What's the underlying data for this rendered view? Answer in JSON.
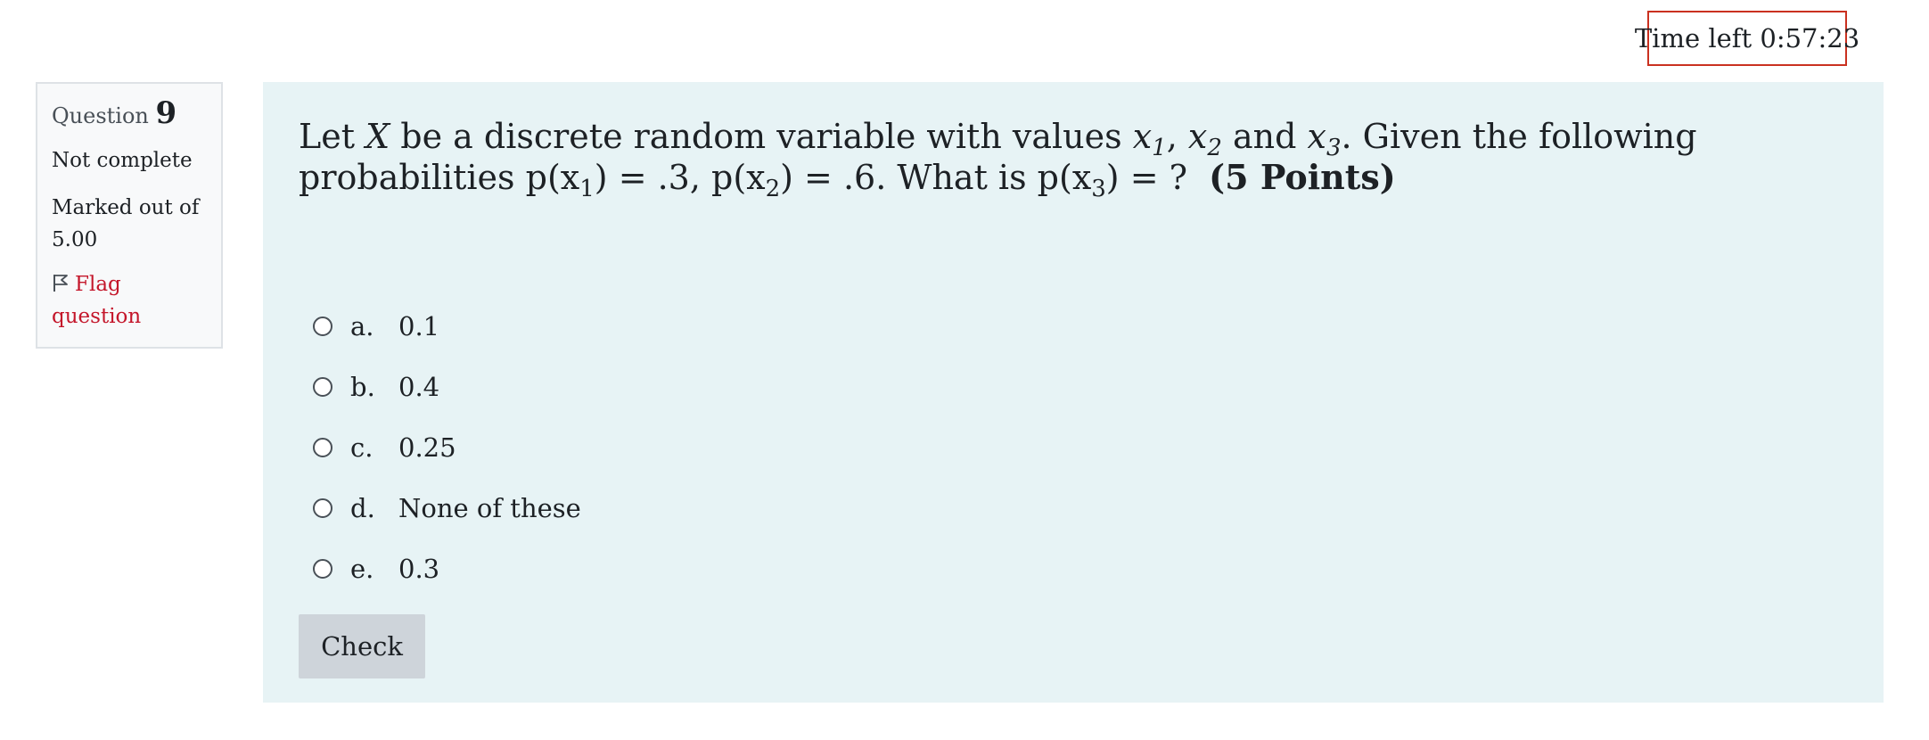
{
  "timer": {
    "label": "Time left",
    "value": "0:57:23"
  },
  "question_info": {
    "prefix": "Question",
    "number": "9",
    "state": "Not complete",
    "grade_line1": "Marked out of",
    "grade_line2": "5.00",
    "flag_line1": "Flag",
    "flag_line2": "question"
  },
  "question": {
    "let": "Let",
    "var_X": "X",
    "t1": "be a discrete random variable with values",
    "x_sym": "x",
    "sub1": "1",
    "sub2": "2",
    "sub3": "3",
    "comma": ",",
    "and": "and",
    "t2": ". Given the following probabilities p(x",
    "t3": ")",
    "t4": "= .3,  p(x",
    "t5": ") = .6. What is p(x",
    "t6": ") = ?",
    "points": "(5 Points)"
  },
  "answers": [
    {
      "letter": "a.",
      "text": "0.1"
    },
    {
      "letter": "b.",
      "text": "0.4"
    },
    {
      "letter": "c.",
      "text": "0.25"
    },
    {
      "letter": "d.",
      "text": "None of these"
    },
    {
      "letter": "e.",
      "text": "0.3"
    }
  ],
  "check_label": "Check"
}
